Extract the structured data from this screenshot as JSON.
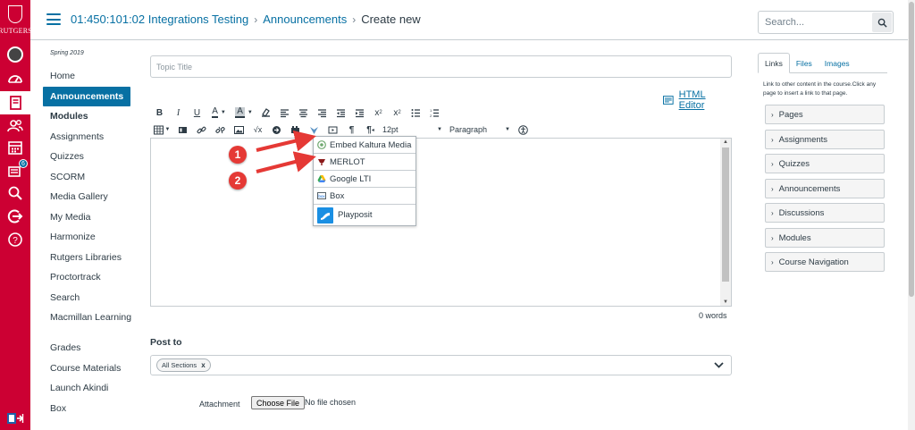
{
  "global_nav": {
    "logo_text": "RUTGERS",
    "items": [
      {
        "icon": "user-avatar-icon"
      },
      {
        "icon": "dashboard-icon"
      },
      {
        "icon": "courses-icon"
      },
      {
        "icon": "groups-icon"
      },
      {
        "icon": "calendar-icon"
      },
      {
        "icon": "inbox-icon",
        "badge": "6"
      },
      {
        "icon": "search-icon"
      },
      {
        "icon": "logout-icon"
      },
      {
        "icon": "help-icon"
      }
    ],
    "collapse_icon": "collapse-nav-icon",
    "accent": "#cc0033"
  },
  "header": {
    "breadcrumb": [
      "01:450:101:02 Integrations Testing",
      "Announcements",
      "Create new"
    ],
    "search_placeholder": "Search..."
  },
  "course_nav": {
    "term": "Spring 2019",
    "items": [
      "Home",
      "Announcements",
      "Modules",
      "Assignments",
      "Quizzes",
      "SCORM",
      "Media Gallery",
      "My Media",
      "Harmonize",
      "Rutgers Libraries",
      "Proctortrack",
      "Search",
      "Macmillan Learning",
      "Grades",
      "Course Materials",
      "Launch Akindi",
      "Box"
    ],
    "active_index": 1
  },
  "editor": {
    "topic_placeholder": "Topic Title",
    "html_editor_label": "HTML Editor",
    "font_size": "12pt",
    "block_format": "Paragraph",
    "word_count": "0 words"
  },
  "lti_dropdown": {
    "items": [
      {
        "label": "Embed Kaltura Media",
        "icon": "kaltura-icon"
      },
      {
        "label": "MERLOT",
        "icon": "merlot-icon"
      },
      {
        "label": "Google LTI",
        "icon": "google-drive-icon"
      },
      {
        "label": "Box",
        "icon": "box-icon"
      },
      {
        "label": "Playposit",
        "icon": "playposit-icon"
      }
    ]
  },
  "callouts": [
    "1",
    "2"
  ],
  "post_to": {
    "label": "Post to",
    "tag": "All Sections",
    "tag_remove": "x"
  },
  "attachment": {
    "label": "Attachment",
    "button": "Choose File",
    "status": "No file chosen"
  },
  "sidebar": {
    "tabs": [
      "Links",
      "Files",
      "Images"
    ],
    "active_tab": 0,
    "description": "Link to other content in the course.Click any page to insert a link to that page.",
    "items": [
      "Pages",
      "Assignments",
      "Quizzes",
      "Announcements",
      "Discussions",
      "Modules",
      "Course Navigation"
    ]
  }
}
